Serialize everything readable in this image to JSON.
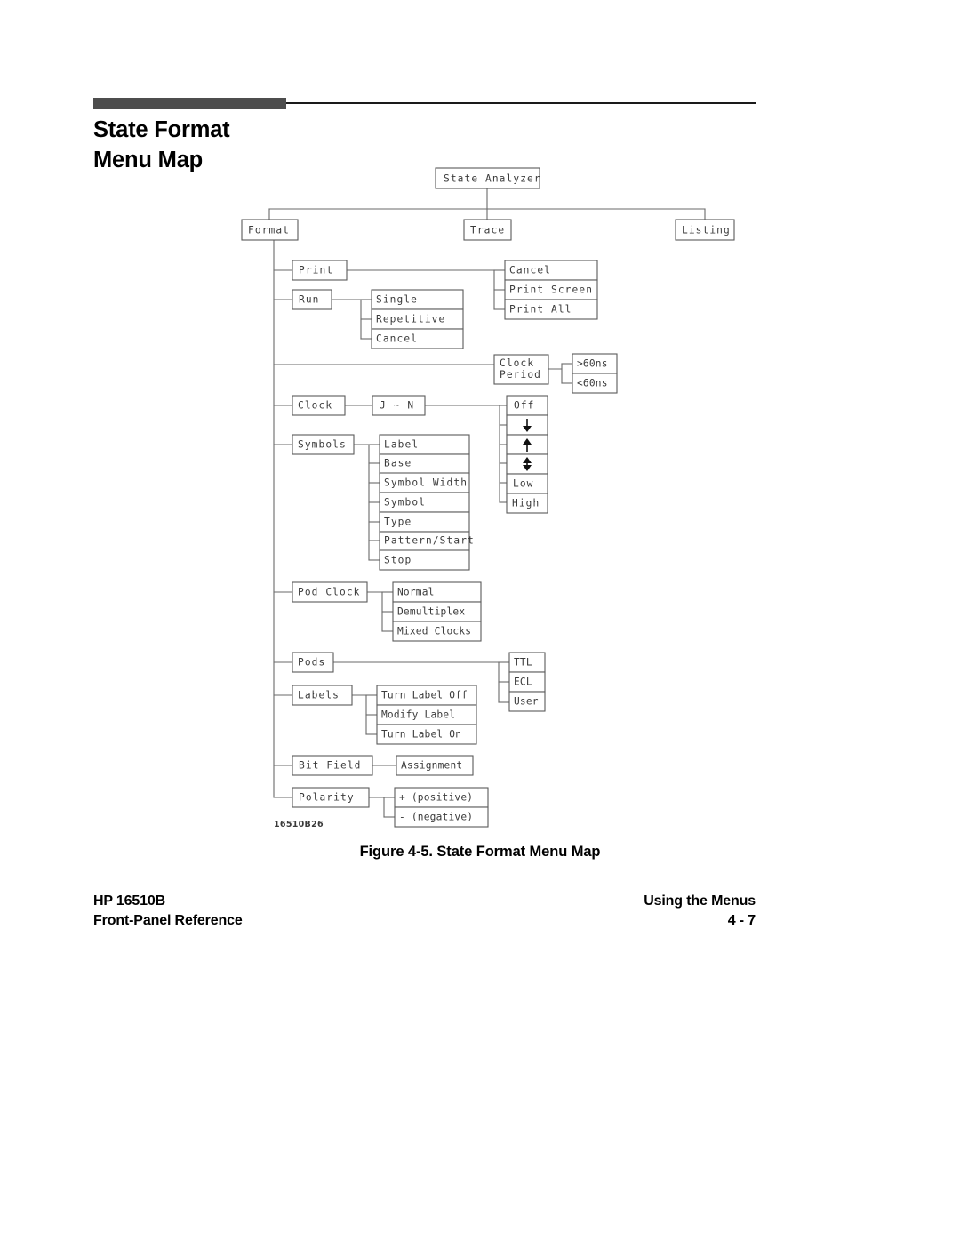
{
  "header": {
    "title_line1": "State Format",
    "title_line2": "Menu Map"
  },
  "figure": {
    "caption": "Figure 4-5. State Format Menu Map",
    "figure_id": "16510B26"
  },
  "footer": {
    "left_line1": "HP 16510B",
    "left_line2": "Front-Panel Reference",
    "right_line1": "Using the Menus",
    "right_line2": "4 - 7"
  },
  "diagram": {
    "root": "State Analyzer",
    "level1": [
      "Format",
      "Trace",
      "Listing"
    ],
    "format_menu": [
      "Print",
      "Run",
      "Clock Period",
      "Clock",
      "Symbols",
      "Pod Clock",
      "Pods",
      "Labels",
      "Bit Field",
      "Polarity"
    ],
    "print_options": [
      "Cancel",
      "Print Screen",
      "Print All"
    ],
    "run_options": [
      "Single",
      "Repetitive",
      "Cancel"
    ],
    "clock_period_label_line1": "Clock",
    "clock_period_label_line2": "Period",
    "clock_period_options": [
      ">60ns",
      "<60ns"
    ],
    "clock_child": "J ~ N",
    "clock_edge_options": [
      "Off",
      "falling-edge-arrow",
      "rising-edge-arrow",
      "both-edges-arrow",
      "Low",
      "High"
    ],
    "symbols_options": [
      "Label",
      "Base",
      "Symbol Width",
      "Symbol",
      "Type",
      "Pattern/Start",
      "Stop"
    ],
    "pod_clock_options": [
      "Normal",
      "Demultiplex",
      "Mixed Clocks"
    ],
    "pods_options": [
      "TTL",
      "ECL",
      "User"
    ],
    "labels_options": [
      "Turn Label Off",
      "Modify Label",
      "Turn Label On"
    ],
    "bit_field_options": [
      "Assignment"
    ],
    "polarity_options": [
      "+ (positive)",
      "- (negative)"
    ]
  },
  "colors": {
    "rule_thick": "#4d4d4d",
    "rule_thin": "#1a1a1a",
    "box_stroke": "#5a5a5a",
    "line_stroke": "#6a6a6a",
    "diagram_text": "#3b3b3b",
    "body_text": "#000000"
  }
}
